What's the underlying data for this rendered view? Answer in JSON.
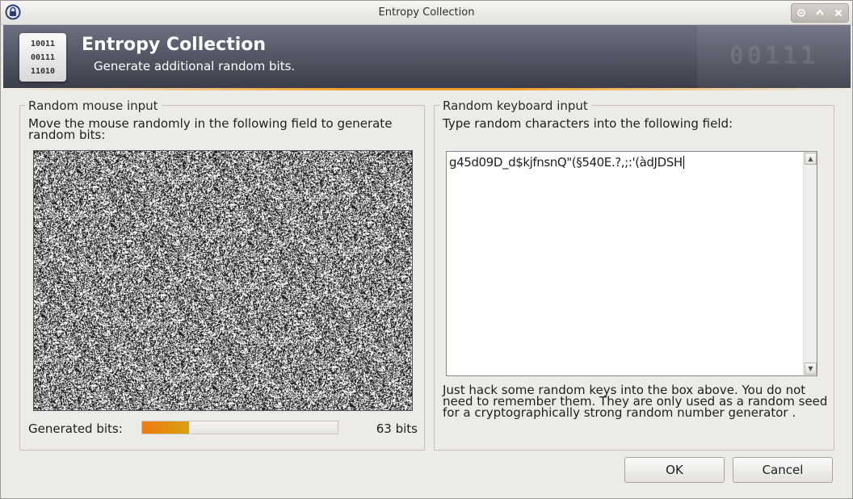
{
  "window": {
    "title": "Entropy Collection",
    "icon": "lock-icon"
  },
  "banner": {
    "title": "Entropy Collection",
    "subtitle": "Generate additional random bits.",
    "logo_lines": [
      "10011",
      "00111",
      "11010"
    ],
    "watermark": "00111"
  },
  "mouse": {
    "group_title": "Random mouse input",
    "instruction": "Move the mouse randomly in the following field to generate random bits:",
    "generated_label": "Generated bits:",
    "bits_text": "63 bits",
    "progress_fraction": 0.24,
    "progress_colors": [
      "#f07a10",
      "#d9a010"
    ]
  },
  "keyboard": {
    "group_title": "Random keyboard input",
    "instruction": "Type random characters into the following field:",
    "input_value": "g45d09D_d$kjfnsnQ\"(§540E.?,;:'(àdJDSH",
    "hint": "Just hack some random keys into the box above. You do not need to remember them. They are only used as a random seed for a cryptographically strong random number generator ."
  },
  "buttons": {
    "ok": "OK",
    "cancel": "Cancel"
  },
  "colors": {
    "banner_top": "#6c7080",
    "banner_bottom": "#3b3e4a",
    "accent": "#f3a12e",
    "window_bg": "#edebe8"
  }
}
